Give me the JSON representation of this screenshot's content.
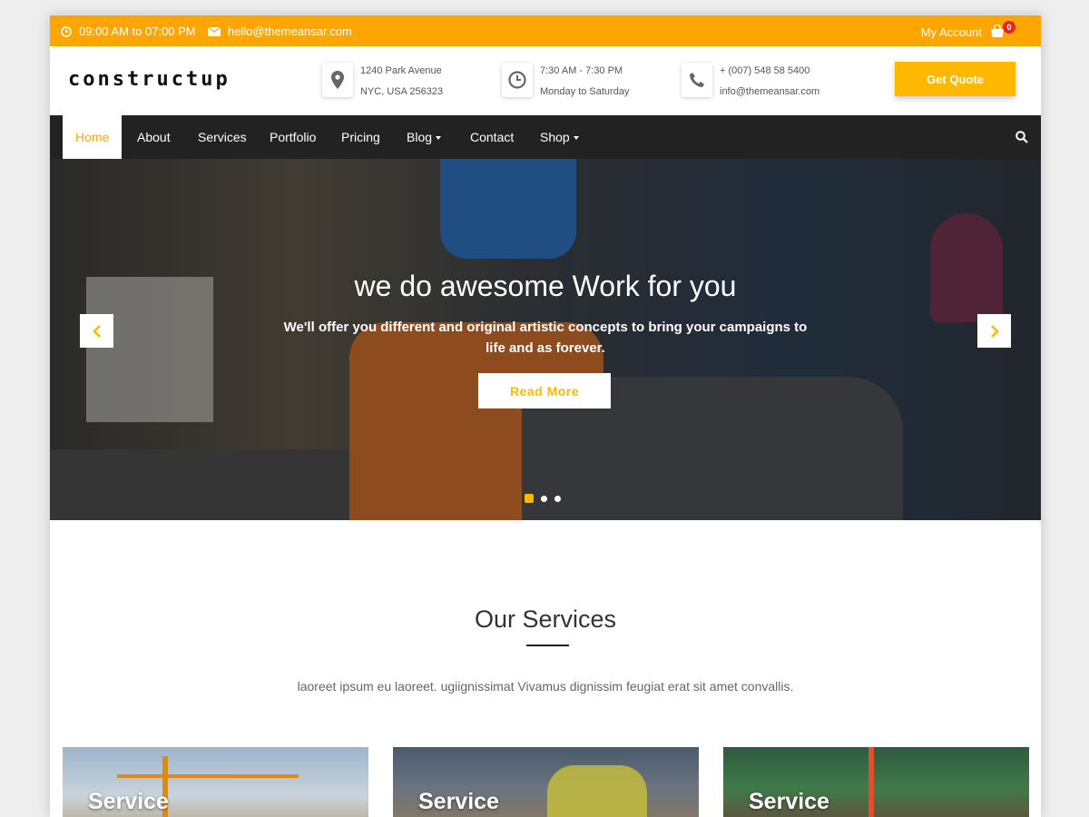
{
  "topbar": {
    "hours": "09:00 AM to 07:00 PM",
    "email": "hello@themeansar.com",
    "account": "My Account",
    "cart_count": "0",
    "color": "#ffa500"
  },
  "header": {
    "logo": "constructup",
    "address": {
      "icon": "map-pin-icon",
      "line1": "1240 Park Avenue",
      "line2": "NYC, USA 256323"
    },
    "hours": {
      "icon": "clock-icon",
      "line1": "7:30 AM - 7:30 PM",
      "line2": "Monday to Saturday"
    },
    "contact": {
      "icon": "phone-icon",
      "line1": "+ (007) 548 58 5400",
      "line2": "info@themeansar.com"
    },
    "quote_button": "Get Quote",
    "accent": "#ffb800"
  },
  "nav": {
    "items": [
      {
        "label": "Home",
        "active": true
      },
      {
        "label": "About"
      },
      {
        "label": "Services"
      },
      {
        "label": "Portfolio"
      },
      {
        "label": "Pricing"
      },
      {
        "label": "Blog",
        "dropdown": true
      },
      {
        "label": "Contact"
      },
      {
        "label": "Shop",
        "dropdown": true
      }
    ],
    "search_icon": "search-icon"
  },
  "hero": {
    "title": "we do awesome Work for you",
    "subtitle": "We'll offer you different and original artistic concepts to bring your campaigns to life and as forever.",
    "button": "Read More",
    "prev_icon": "chevron-left-icon",
    "next_icon": "chevron-right-icon",
    "slide_count": 3,
    "active_slide": 1
  },
  "services": {
    "title": "Our Services",
    "description": "laoreet ipsum eu laoreet. ugiignissimat Vivamus dignissim feugiat erat sit amet convallis.",
    "cards": [
      {
        "title": "Service"
      },
      {
        "title": "Service"
      },
      {
        "title": "Service"
      }
    ]
  }
}
